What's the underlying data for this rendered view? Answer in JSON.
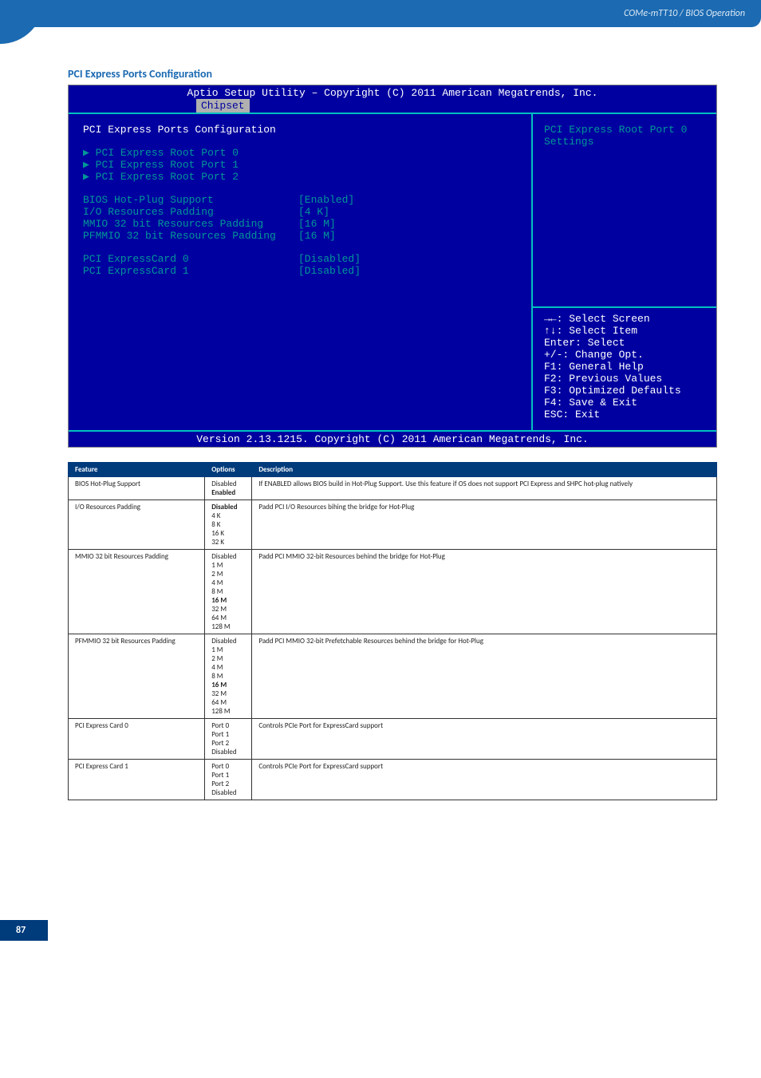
{
  "header": {
    "breadcrumb": "COMe-mTT10 / BIOS Operation"
  },
  "section_title": "PCI Express Ports Configuration",
  "bios": {
    "header": "Aptio Setup Utility – Copyright (C) 2011 American Megatrends, Inc.",
    "tab": "Chipset",
    "main_title": "PCI Express Ports Configuration",
    "root_ports": [
      "PCI Express Root Port 0",
      "PCI Express Root Port 1",
      "PCI Express Root Port 2"
    ],
    "settings": [
      {
        "label": "BIOS Hot-Plug Support",
        "value": "[Enabled]"
      },
      {
        "label": "I/O Resources Padding",
        "value": "[4 K]"
      },
      {
        "label": "MMIO 32 bit Resources Padding",
        "value": "[16 M]"
      },
      {
        "label": "PFMMIO 32 bit Resources Padding",
        "value": "[16 M]"
      }
    ],
    "cards": [
      {
        "label": "PCI ExpressCard 0",
        "value": "[Disabled]"
      },
      {
        "label": "PCI ExpressCard 1",
        "value": "[Disabled]"
      }
    ],
    "help_top": "PCI Express Root Port 0\nSettings",
    "help_nav": [
      "→←: Select Screen",
      "↑↓: Select Item",
      "Enter: Select",
      "+/-: Change Opt.",
      "F1: General Help",
      "F2: Previous Values",
      "F3: Optimized Defaults",
      "F4: Save & Exit",
      "ESC: Exit"
    ],
    "footer": "Version 2.13.1215. Copyright (C) 2011 American Megatrends, Inc."
  },
  "table": {
    "headers": [
      "Feature",
      "Options",
      "Description"
    ],
    "rows": [
      {
        "feature": "BIOS Hot-Plug Support",
        "options": [
          "Disabled",
          "Enabled"
        ],
        "bold": [
          "Enabled"
        ],
        "desc": "If ENABLED allows BIOS build in Hot-Plug Support. Use this feature if OS does not support PCI Express and SHPC hot-plug natively"
      },
      {
        "feature": "I/O Resources Padding",
        "options": [
          "Disabled",
          "4 K",
          "8 K",
          "16 K",
          "32 K"
        ],
        "bold": [
          "Disabled"
        ],
        "desc": "Padd PCI I/O Resources bihing the bridge for Hot-Plug"
      },
      {
        "feature": "MMIO 32 bit Resources Padding",
        "options": [
          "Disabled",
          "1 M",
          "2 M",
          "4 M",
          "8 M",
          "16 M",
          "32 M",
          "64 M",
          "128 M"
        ],
        "bold": [
          "16 M"
        ],
        "desc": "Padd PCI MMIO 32-bit Resources behind the bridge for Hot-Plug"
      },
      {
        "feature": "PFMMIO 32 bit Resources Padding",
        "options": [
          "Disabled",
          "1 M",
          "2 M",
          "4 M",
          "8 M",
          "16 M",
          "32 M",
          "64 M",
          "128 M"
        ],
        "bold": [
          "16 M"
        ],
        "desc": "Padd PCI MMIO 32-bit Prefetchable Resources behind the bridge for Hot-Plug"
      },
      {
        "feature": "PCI Express Card 0",
        "options": [
          "Port 0",
          "Port 1",
          "Port 2",
          "Disabled"
        ],
        "bold": [],
        "desc": "Controls PCIe Port for ExpressCard support"
      },
      {
        "feature": "PCI Express Card 1",
        "options": [
          "Port 0",
          "Port 1",
          "Port 2",
          "Disabled"
        ],
        "bold": [],
        "desc": "Controls PCIe Port for ExpressCard support"
      }
    ]
  },
  "page_number": "87"
}
